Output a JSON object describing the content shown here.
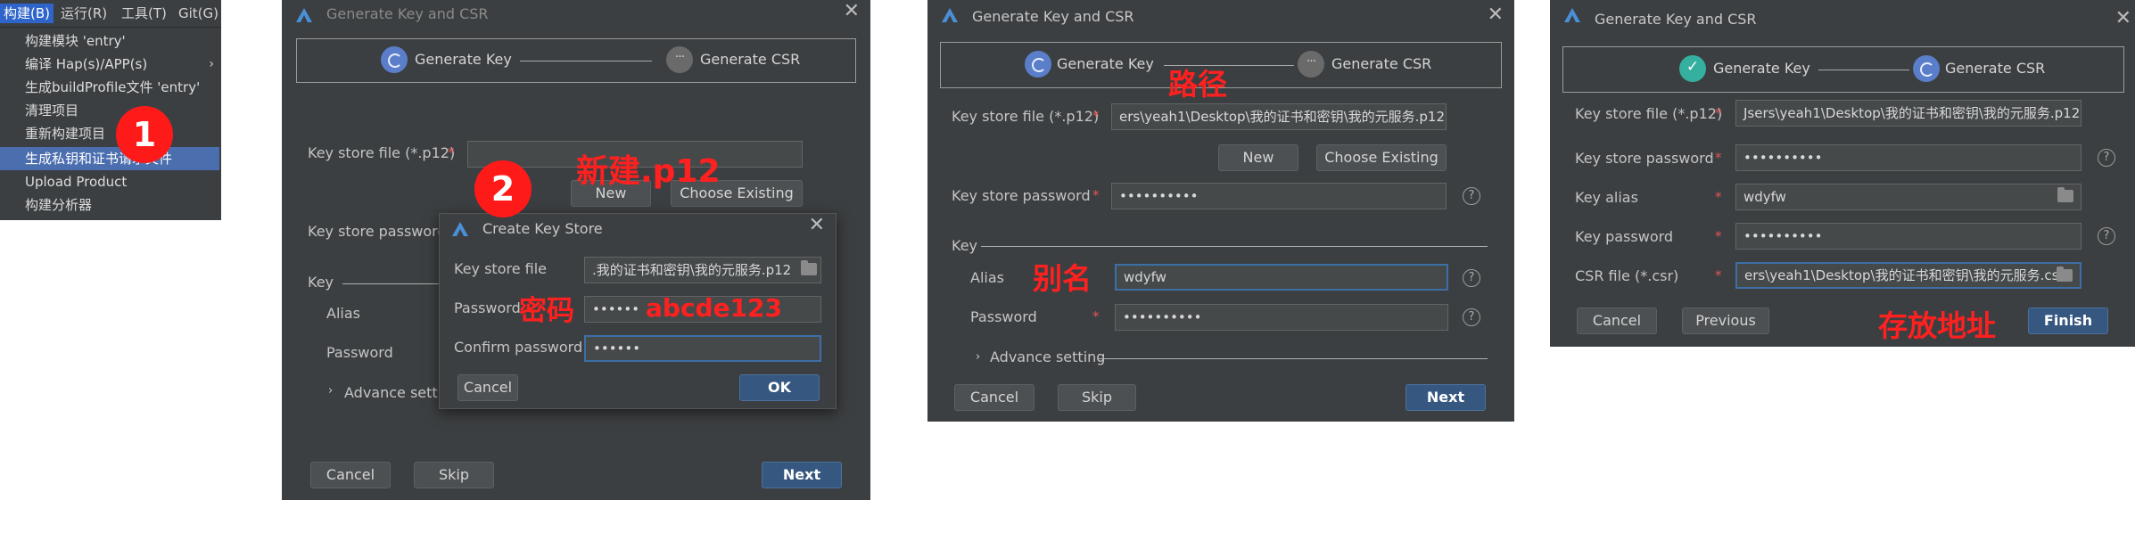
{
  "menu": {
    "bar": [
      "构建(B)",
      "运行(R)",
      "工具(T)",
      "Git(G)"
    ],
    "items": [
      "构建模块 'entry'",
      "编译 Hap(s)/APP(s)",
      "生成buildProfile文件 'entry'",
      "清理项目",
      "重新构建项目",
      "生成私钥和证书请求文件",
      "Upload Product",
      "构建分析器"
    ],
    "submenu_arrow": "›",
    "badge": "1"
  },
  "common": {
    "dialog_title": "Generate Key and CSR",
    "close": "✕",
    "step1": "Generate Key",
    "step2": "Generate CSR",
    "req": "*",
    "help": "?",
    "caret": "›"
  },
  "panel2": {
    "keystore_label": "Key store file (*.p12)",
    "keystore_value": "",
    "new_button": "New",
    "choose_button": "Choose Existing",
    "keystore_password_label": "Key store password",
    "key_section": "Key",
    "alias_label": "Alias",
    "password_label": "Password",
    "advanced": "Advance settin",
    "cancel": "Cancel",
    "skip": "Skip",
    "next": "Next",
    "badge": "2",
    "annot_new": "新建.p12",
    "annot_pwd": "密码",
    "annot_pwd_value": "abcde123",
    "sub": {
      "title": "Create Key Store",
      "keystore_label": "Key store file",
      "keystore_value": ".我的证书和密钥\\我的元服务.p12",
      "password_label": "Password",
      "password_value": "••••••",
      "confirm_label": "Confirm password",
      "confirm_value": "••••••",
      "cancel": "Cancel",
      "ok": "OK"
    }
  },
  "panel3": {
    "keystore_label": "Key store file (*.p12)",
    "keystore_value": "ers\\yeah1\\Desktop\\我的证书和密钥\\我的元服务.p12",
    "new_button": "New",
    "choose_button": "Choose Existing",
    "keystore_password_label": "Key store password",
    "keystore_password_value": "••••••••••",
    "key_section": "Key",
    "alias_label": "Alias",
    "alias_value": "wdyfw",
    "password_label": "Password",
    "password_value": "••••••••••",
    "advanced": "Advance setting",
    "cancel": "Cancel",
    "skip": "Skip",
    "next": "Next",
    "annot_path": "路径",
    "annot_alias": "别名"
  },
  "panel4": {
    "keystore_label": "Key store file (*.p12)",
    "keystore_value": "Jsers\\yeah1\\Desktop\\我的证书和密钥\\我的元服务.p12",
    "keystore_password_label": "Key store password",
    "keystore_password_value": "••••••••••",
    "alias_label": "Key alias",
    "alias_value": "wdyfw",
    "key_password_label": "Key password",
    "key_password_value": "••••••••••",
    "csr_label": "CSR file (*.csr)",
    "csr_value": "ers\\yeah1\\Desktop\\我的证书和密钥\\我的元服务.csr",
    "cancel": "Cancel",
    "previous": "Previous",
    "finish": "Finish",
    "annot_location": "存放地址"
  },
  "colors": {
    "dialog_bg": "#3c3f41",
    "accent": "#365880",
    "annotation": "#ff2020",
    "success": "#35b0a0"
  }
}
